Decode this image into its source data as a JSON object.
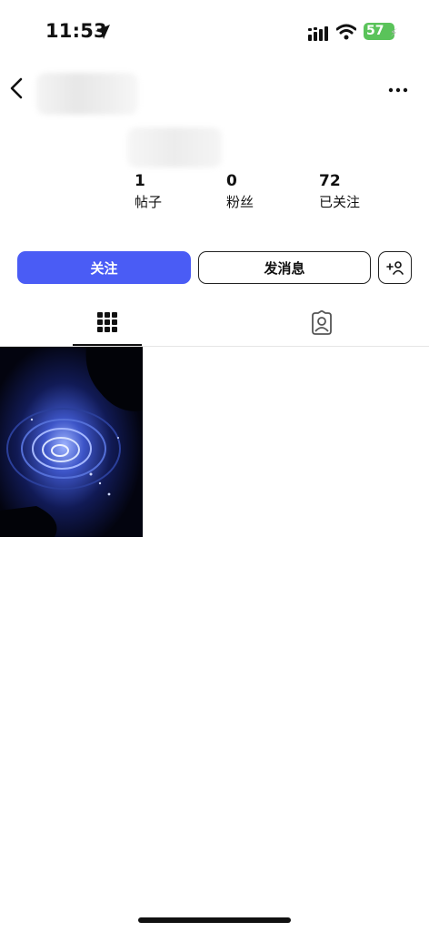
{
  "status_bar": {
    "time": "11:53",
    "battery_level": "57"
  },
  "header": {
    "back_icon": "chevron-left-icon",
    "more_icon": "ellipsis-icon"
  },
  "profile": {
    "stats": [
      {
        "value": "1",
        "label": "帖子"
      },
      {
        "value": "0",
        "label": "粉丝"
      },
      {
        "value": "72",
        "label": "已关注"
      }
    ]
  },
  "actions": {
    "follow_label": "关注",
    "message_label": "发消息",
    "add_user_icon": "add-person-icon"
  },
  "tabs": [
    {
      "icon": "grid-icon",
      "selected": true
    },
    {
      "icon": "tagged-person-icon",
      "selected": false
    }
  ],
  "posts": [
    {
      "icon": "water-ripple-photo"
    }
  ],
  "colors": {
    "accent": "#4a5cf5",
    "battery": "#5ac35a"
  }
}
